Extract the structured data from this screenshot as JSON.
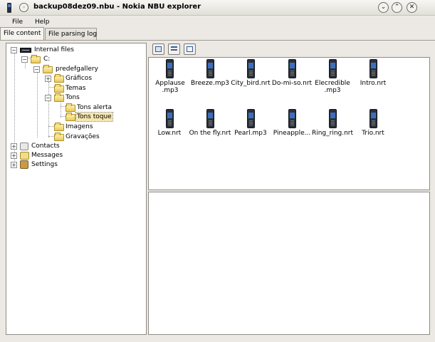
{
  "window": {
    "title": "backup08dez09.nbu - Nokia NBU explorer",
    "icon": "phone-icon",
    "controls": [
      "minimize-icon",
      "maximize-icon",
      "close-icon"
    ]
  },
  "menu": {
    "items": [
      "File",
      "Help"
    ]
  },
  "tabs": [
    {
      "label": "File content",
      "active": true
    },
    {
      "label": "File parsing log",
      "active": false
    }
  ],
  "tree": {
    "nodes": [
      {
        "label": "Internal files",
        "icon": "memory-icon",
        "expanded": true
      },
      {
        "label": "C:",
        "icon": "folder-icon",
        "expanded": true
      },
      {
        "label": "predefgallery",
        "icon": "folder-icon",
        "expanded": true
      },
      {
        "label": "Gráficos",
        "icon": "folder-icon",
        "expanded": false
      },
      {
        "label": "Temas",
        "icon": "folder-icon"
      },
      {
        "label": "Tons",
        "icon": "folder-icon",
        "expanded": true
      },
      {
        "label": "Tons alerta",
        "icon": "folder-icon"
      },
      {
        "label": "Tons toque",
        "icon": "folder-icon",
        "selected": true
      },
      {
        "label": "Imagens",
        "icon": "folder-icon"
      },
      {
        "label": "Gravações",
        "icon": "folder-icon"
      },
      {
        "label": "Contacts",
        "icon": "contact-icon",
        "expanded": false
      },
      {
        "label": "Messages",
        "icon": "message-icon",
        "expanded": false
      },
      {
        "label": "Settings",
        "icon": "settings-icon",
        "expanded": false
      }
    ]
  },
  "files": [
    {
      "name": "Applause .mp3"
    },
    {
      "name": "Breeze.mp3"
    },
    {
      "name": "City_bird.nrt"
    },
    {
      "name": "Do-mi-so.nrt"
    },
    {
      "name": "Elecredible .mp3"
    },
    {
      "name": "Intro.nrt"
    },
    {
      "name": "Low.nrt"
    },
    {
      "name": "On the fly.nrt"
    },
    {
      "name": "Pearl.mp3"
    },
    {
      "name": "Pineapple..."
    },
    {
      "name": "Ring_ring.nrt"
    },
    {
      "name": "Trio.nrt"
    }
  ]
}
